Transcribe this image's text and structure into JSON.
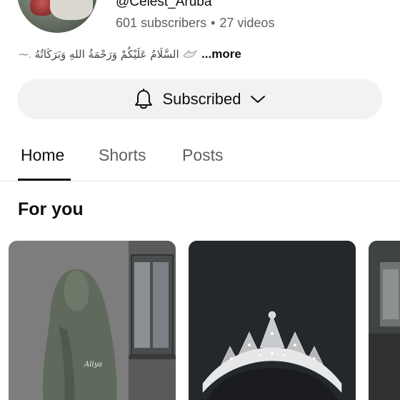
{
  "channel": {
    "handle": "@Celest_Aruba",
    "subscribers": "601 subscribers",
    "separator": "•",
    "videos": "27 videos",
    "description_arabic": "السَّلَامُ عَلَيْكُمْ وَرَحْمَةُ اللهِ وَبَرَكَاتُهُ",
    "description_more": "...more"
  },
  "subscribe": {
    "label": "Subscribed",
    "icon": "bell-icon",
    "dropdown_icon": "chevron-down-icon"
  },
  "tabs": [
    {
      "label": "Home",
      "active": true
    },
    {
      "label": "Shorts",
      "active": false
    },
    {
      "label": "Posts",
      "active": false
    }
  ],
  "section": {
    "title": "For you"
  },
  "cards": [
    {
      "caption": "Aliya"
    },
    {
      "caption": ""
    },
    {
      "caption": ""
    }
  ],
  "colors": {
    "button_bg": "#f2f2f2",
    "text_primary": "#0f0f0f",
    "text_secondary": "#606060"
  }
}
